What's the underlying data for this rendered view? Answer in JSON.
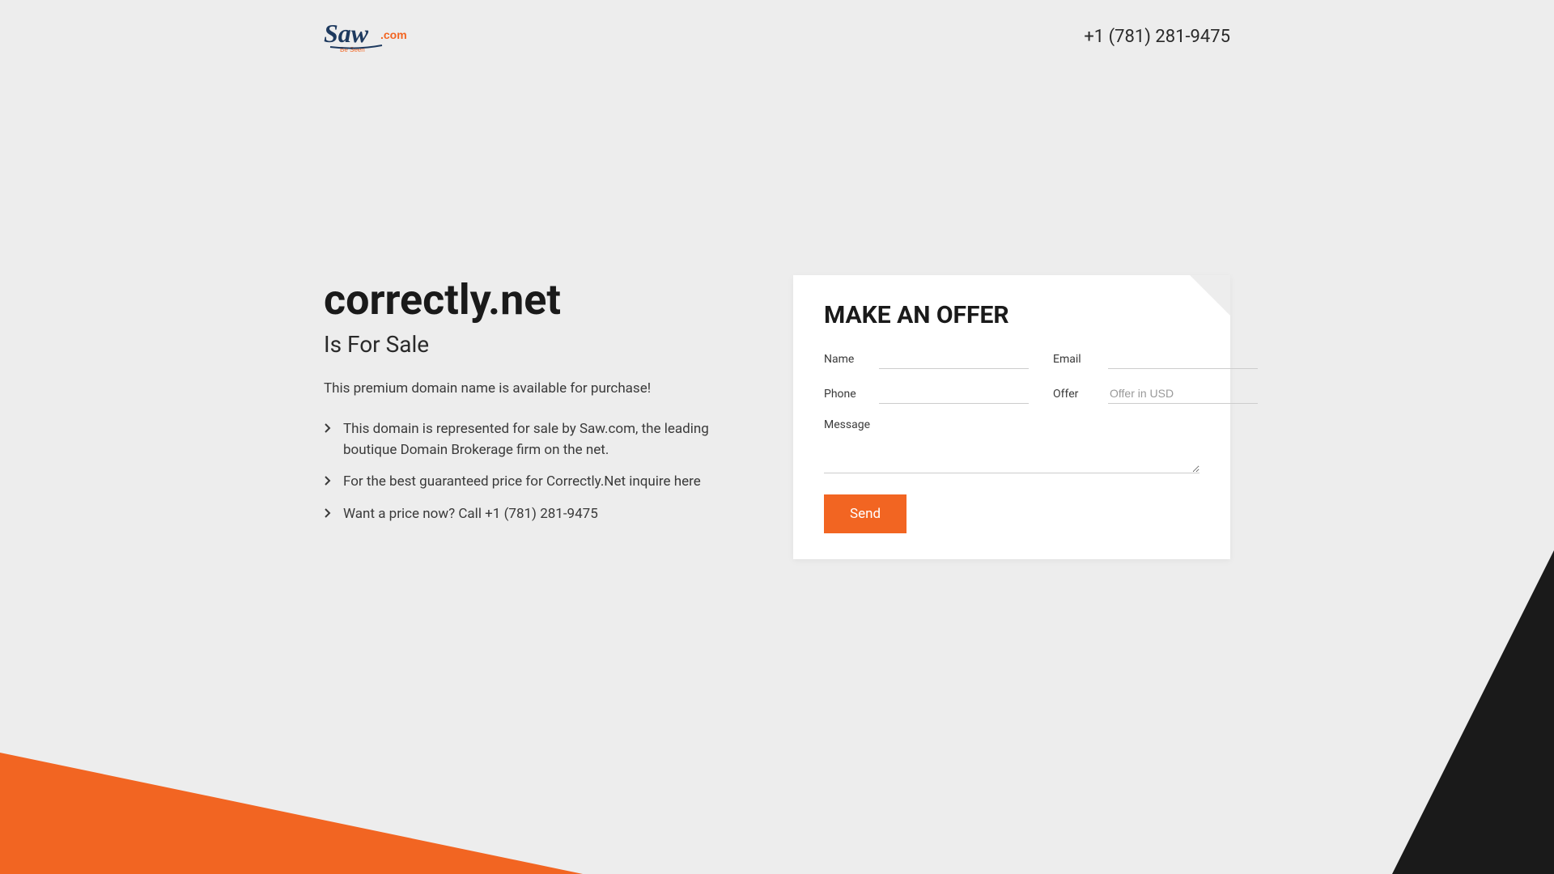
{
  "header": {
    "logo_main": "Saw",
    "logo_suffix": ".com",
    "logo_tagline": "Be Seen",
    "phone": "+1 (781) 281-9475"
  },
  "main": {
    "domain": "correctly.net",
    "subtitle": "Is For Sale",
    "description": "This premium domain name is available for purchase!",
    "bullets": [
      "This domain is represented for sale by Saw.com, the leading boutique Domain Brokerage firm on the net.",
      "For the best guaranteed price for Correctly.Net inquire here",
      "Want a price now? Call +1 (781) 281-9475"
    ]
  },
  "form": {
    "title": "MAKE AN OFFER",
    "name_label": "Name",
    "email_label": "Email",
    "phone_label": "Phone",
    "offer_label": "Offer",
    "offer_placeholder": "Offer in USD",
    "message_label": "Message",
    "send_label": "Send"
  }
}
